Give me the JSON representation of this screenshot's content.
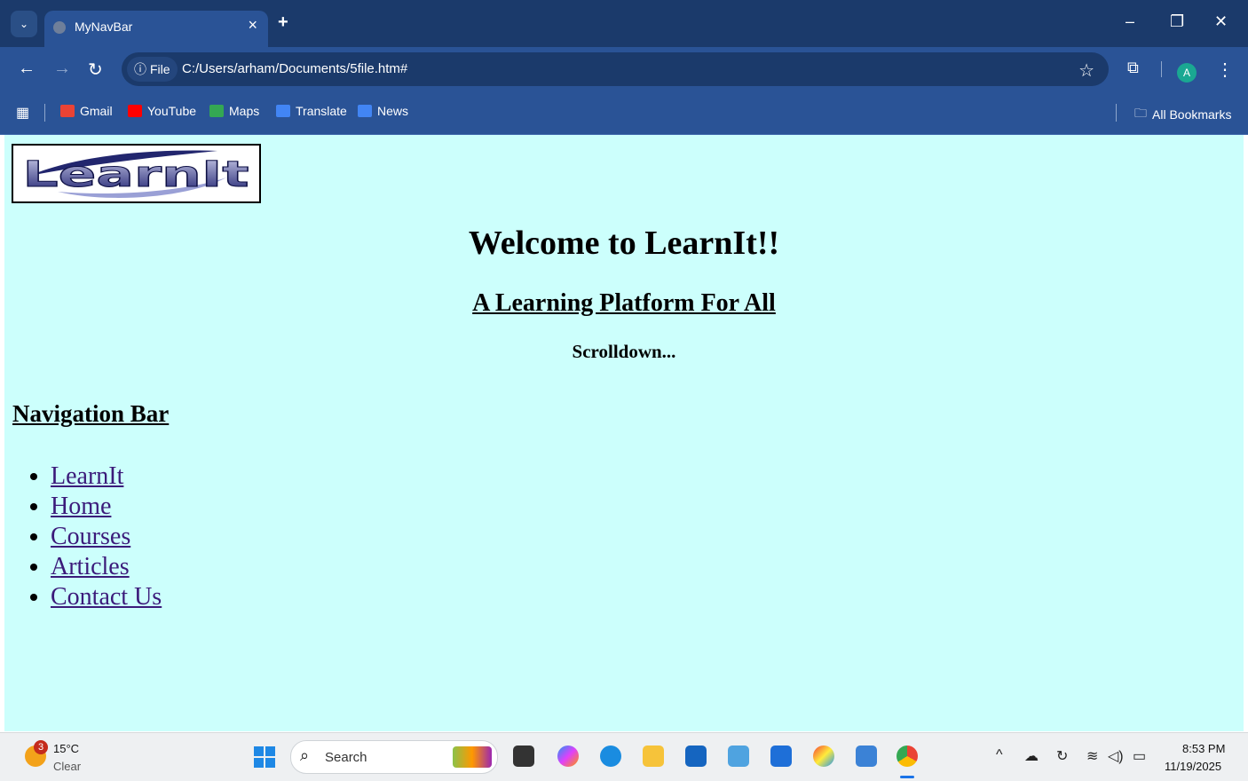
{
  "browser": {
    "tab_title": "MyNavBar",
    "tab_close": "×",
    "new_tab": "+",
    "file_chip": "File",
    "url": "C:/Users/arham/Documents/5file.htm#",
    "profile_initial": "A",
    "bookmarks": [
      {
        "label": "Gmail",
        "icon": "gmail-icon",
        "color": "#ea4335"
      },
      {
        "label": "YouTube",
        "icon": "youtube-icon",
        "color": "#ff0000"
      },
      {
        "label": "Maps",
        "icon": "maps-icon",
        "color": "#34a853"
      },
      {
        "label": "Translate",
        "icon": "translate-icon",
        "color": "#4285f4"
      },
      {
        "label": "News",
        "icon": "news-icon",
        "color": "#4285f4"
      }
    ],
    "all_bookmarks": "All Bookmarks"
  },
  "page": {
    "logo_text": "LearnIt",
    "welcome": "Welcome to LearnIt!!",
    "tagline": "A Learning Platform For All",
    "scroll_hint": "Scrolldown...",
    "nav_heading": "Navigation Bar",
    "nav_links": [
      "LearnIt",
      "Home",
      "Courses",
      "Articles",
      "Contact Us"
    ],
    "background_color": "#ccfffc",
    "link_color": "#3b1a7a"
  },
  "taskbar": {
    "weather_badge": "3",
    "temperature": "15°C",
    "condition": "Clear",
    "search_label": "Search",
    "time": "8:53 PM",
    "date": "11/19/2025"
  }
}
